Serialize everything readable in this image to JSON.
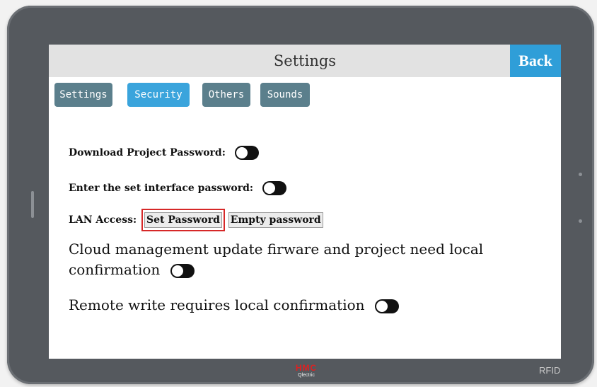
{
  "header": {
    "title": "Settings",
    "back_label": "Back"
  },
  "tabs": [
    {
      "label": "Settings",
      "active": false
    },
    {
      "label": "Security",
      "active": true
    },
    {
      "label": "Others",
      "active": false
    },
    {
      "label": "Sounds",
      "active": false
    }
  ],
  "security": {
    "download_project_password_label": "Download Project Password:",
    "enter_set_interface_password_label": "Enter the set interface password:",
    "lan_access_label": "LAN Access:",
    "set_password_label": "Set Password",
    "empty_password_label": "Empty password",
    "cloud_update_label_line1": "Cloud management update firware and project need local",
    "cloud_update_label_line2": "confirmation",
    "remote_write_label": "Remote write requires local confirmation"
  },
  "device": {
    "brand": "HMC",
    "brand_sub": "Qlectric",
    "rfid_label": "RFID"
  },
  "colors": {
    "accent": "#3aa4dc",
    "tab": "#5b7f8c",
    "back": "#2f9ed8",
    "highlight": "#d62828",
    "toggle": "#111111"
  },
  "icons": {
    "toggle": "toggle-switch-icon",
    "rfid": "rfid-icon"
  }
}
